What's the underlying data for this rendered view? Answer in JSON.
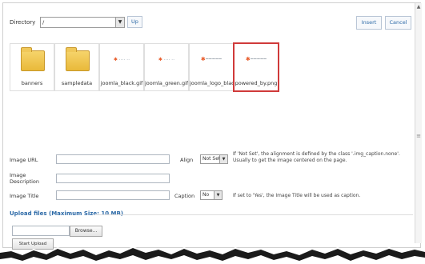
{
  "directory": {
    "label": "Directory",
    "value": "/",
    "up_label": "Up"
  },
  "actions": {
    "insert_label": "Insert",
    "cancel_label": "Cancel"
  },
  "thumbnails": [
    {
      "caption": "banners",
      "kind": "folder",
      "selected": false
    },
    {
      "caption": "sampledata",
      "kind": "folder",
      "selected": false
    },
    {
      "caption": "joomla_black.gif",
      "kind": "image",
      "selected": false
    },
    {
      "caption": "joomla_green.gif",
      "kind": "image",
      "selected": false
    },
    {
      "caption": "joomla_logo_blac",
      "kind": "image",
      "selected": false
    },
    {
      "caption": "powered_by.png",
      "kind": "image",
      "selected": true
    }
  ],
  "form": {
    "image_url_label": "Image URL",
    "align_label": "Align",
    "align_value": "Not Set",
    "align_note": "If 'Not Set', the alignment is defined by the class '.img_caption.none'. Usually to get the image centered on the page.",
    "image_description_label": "Image Description",
    "image_title_label": "Image Title",
    "caption_label": "Caption",
    "caption_value": "No",
    "caption_note": "If set to 'Yes', the Image Title will be used as caption."
  },
  "upload": {
    "title": "Upload files (Maximum Size: 10 MB)",
    "browse_label": "Browse...",
    "start_label": "Start Upload"
  },
  "colors": {
    "accent": "#2d6aa7",
    "selection": "#d03a3a"
  }
}
